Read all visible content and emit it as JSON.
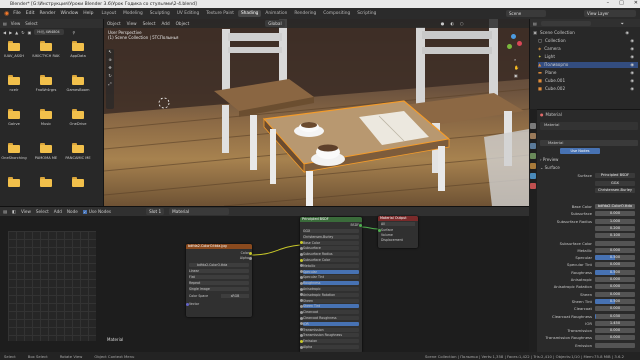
{
  "window": {
    "title": "Blender* [G:\\Инструкция\\Уроки Blender 3.6\\Урок Годика со стульями\\2-4.blend]",
    "controls": [
      "–",
      "□",
      "✕"
    ]
  },
  "menu": [
    "File",
    "Edit",
    "Render",
    "Window",
    "Help"
  ],
  "workspaces": [
    "Layout",
    "Modeling",
    "Sculpting",
    "UV Editing",
    "Texture Paint",
    "Shading",
    "Animation",
    "Rendering",
    "Compositing",
    "Scripting"
  ],
  "active_workspace": "Shading",
  "scene": "Scene",
  "view_layer": "View Layer",
  "file_browser": {
    "header": [
      "View",
      "Select"
    ],
    "path": "H:\\\\\\ 4W4804",
    "folders": [
      {
        "label": "IUAV_ASSH"
      },
      {
        "label": "IUKICTYCH RAK"
      },
      {
        "label": "AppData"
      },
      {
        "label": "ncelr"
      },
      {
        "label": "FnoWr4rgrs"
      },
      {
        "label": "GamesBoom"
      },
      {
        "label": "Galrve"
      },
      {
        "label": "Music"
      },
      {
        "label": "OneDrive"
      },
      {
        "label": "OneShorching"
      },
      {
        "label": "PAMOMA ME"
      },
      {
        "label": "PANCAMIC ME"
      },
      {
        "label": ""
      },
      {
        "label": ""
      },
      {
        "label": ""
      }
    ]
  },
  "viewport": {
    "header": [
      "Object",
      "View",
      "Select",
      "Add",
      "Object"
    ],
    "orientation": "Global",
    "overlay_line1": "User Perspective",
    "overlay_line2": "(1) Scene Collection | 5ТСПолынья"
  },
  "outliner": {
    "items": [
      {
        "label": "Scene Collection",
        "selected": false
      },
      {
        "label": "Collection",
        "selected": false
      },
      {
        "label": "Camera",
        "selected": false
      },
      {
        "label": "Light",
        "selected": false
      },
      {
        "label": "Поливорпо",
        "selected": true
      },
      {
        "label": "Plane",
        "selected": false
      },
      {
        "label": "Cube.001",
        "selected": false
      },
      {
        "label": "Cube.002",
        "selected": false
      }
    ]
  },
  "properties": {
    "title": "Material",
    "material_name": "Material",
    "use_nodes": "Use Nodes",
    "sections": [
      "Preview",
      "Surface"
    ],
    "surface_label": "Surface",
    "surface_value": "Principled BSDF",
    "ggx": "GGX",
    "subsurface_method": "Christensen-Burley",
    "rows": [
      {
        "label": "Base Color",
        "value": "bdfda2.ColorO.ttda",
        "fill": 0
      },
      {
        "label": "Subsurface",
        "value": "0.000",
        "fill": 0
      },
      {
        "label": "Subsurface Radius",
        "value": "1.000",
        "fill": 0
      },
      {
        "label": "",
        "value": "0.200",
        "fill": 0
      },
      {
        "label": "",
        "value": "0.100",
        "fill": 0
      },
      {
        "label": "Subsurface Color",
        "value": "",
        "fill": 0
      },
      {
        "label": "Metallic",
        "value": "0.000",
        "fill": 0
      },
      {
        "label": "Specular",
        "value": "0.500",
        "fill": 50
      },
      {
        "label": "Specular Tint",
        "value": "0.000",
        "fill": 0
      },
      {
        "label": "Roughness",
        "value": "0.500",
        "fill": 50
      },
      {
        "label": "Anisotropic",
        "value": "0.000",
        "fill": 0
      },
      {
        "label": "Anisotropic Rotation",
        "value": "0.000",
        "fill": 0
      },
      {
        "label": "Sheen",
        "value": "0.000",
        "fill": 0
      },
      {
        "label": "Sheen Tint",
        "value": "0.500",
        "fill": 50
      },
      {
        "label": "Clearcoat",
        "value": "0.000",
        "fill": 0
      },
      {
        "label": "Clearcoat Roughness",
        "value": "0.030",
        "fill": 3
      },
      {
        "label": "IOR",
        "value": "1.450",
        "fill": 0
      },
      {
        "label": "Transmission",
        "value": "0.000",
        "fill": 0
      },
      {
        "label": "Transmission Roughness",
        "value": "0.000",
        "fill": 0
      },
      {
        "label": "Emission",
        "value": "",
        "fill": 0
      }
    ]
  },
  "node_editor": {
    "header": [
      "View",
      "Select",
      "Add",
      "Node",
      "Use Nodes"
    ],
    "slot": "Slot 1",
    "material": "Material",
    "label": "Material",
    "tex_node": {
      "title": "bdfda2.ColorO.ttda.jpg",
      "image": "bdfda2.ColorO.ttda",
      "out_color": "Color",
      "out_alpha": "Alpha",
      "opts": [
        "Linear",
        "Flat",
        "Repeat",
        "Single Image"
      ],
      "colorspace_label": "Color Space",
      "colorspace": "sRGB",
      "vector": "Vector"
    },
    "bsdf_node": {
      "title": "Principled BSDF",
      "out": "BSDF",
      "rows": [
        "GGX",
        "Christensen-Burley",
        "Base Color",
        "Subsurface",
        "Subsurface Radius",
        "Subsurface Color",
        "Metallic",
        "Specular",
        "Specular Tint",
        "Roughness",
        "Anisotropic",
        "Anisotropic Rotation",
        "Sheen",
        "Sheen Tint",
        "Clearcoat",
        "Clearcoat Roughness",
        "IOR",
        "Transmission",
        "Transmission Roughness",
        "Emission",
        "Alpha"
      ]
    },
    "out_node": {
      "title": "Material Output",
      "target": "All",
      "rows": [
        "Surface",
        "Volume",
        "Displacement"
      ]
    }
  },
  "status": {
    "left": [
      "Select",
      "Box Select",
      "Rotate View",
      "Object Context Menu"
    ],
    "right": "Scene Collection | Полынья | Verts:1,358 | Faces:1,422 | Tris:2,410 | Objects:1/10 | Mem:75.8 MiB | 3.6.2"
  },
  "colors": {
    "accent": "#4772b3",
    "selected": "#334d80",
    "folder": "#f2c04b",
    "select_outline": "#f39b2a"
  }
}
